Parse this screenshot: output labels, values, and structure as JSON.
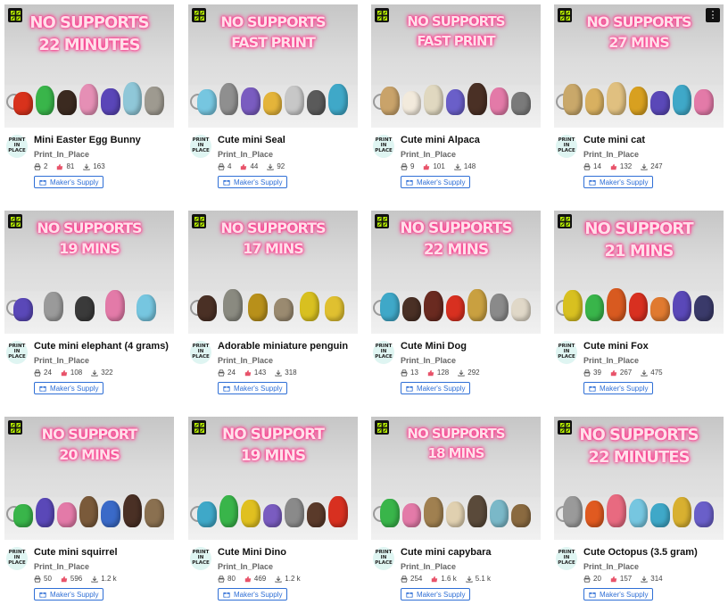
{
  "cards": [
    {
      "title": "Mini Easter Egg Bunny",
      "author": "Print_In_Place",
      "makes": "2",
      "likes": "81",
      "downloads": "163",
      "supply": "Maker's Supply",
      "headline": [
        "NO SUPPORTS",
        "22 MINUTES"
      ],
      "logo": [
        "PRINT",
        "IN",
        "PLACE"
      ],
      "colors": [
        "#d8321c",
        "#39b54a",
        "#3b2a20",
        "#e58fb5",
        "#5a46b8",
        "#8fc7d8",
        "#9e9a90"
      ]
    },
    {
      "title": "Cute mini Seal",
      "author": "Print_In_Place",
      "makes": "4",
      "likes": "44",
      "downloads": "92",
      "supply": "Maker's Supply",
      "headline": [
        "NO SUPPORTS",
        "FAST PRINT"
      ],
      "logo": [
        "PRINT",
        "IN",
        "PLACE"
      ],
      "colors": [
        "#76c6e0",
        "#8f8f8f",
        "#7a5cc0",
        "#e4b43a",
        "#c7c7c7",
        "#5a5a5a",
        "#3fa8c8"
      ]
    },
    {
      "title": "Cute mini Alpaca",
      "author": "Print_In_Place",
      "makes": "9",
      "likes": "101",
      "downloads": "148",
      "supply": "Maker's Supply",
      "headline": [
        "NO SUPPORTS",
        "FAST PRINT"
      ],
      "logo": [
        "PRINT",
        "IN",
        "PLACE"
      ],
      "colors": [
        "#c9a36a",
        "#f2eadc",
        "#e0d8c0",
        "#6a5fc9",
        "#4a3025",
        "#e37aa8",
        "#7a7a7a"
      ]
    },
    {
      "title": "Cute mini cat",
      "author": "Print_In_Place",
      "makes": "14",
      "likes": "132",
      "downloads": "247",
      "supply": "Maker's Supply",
      "headline": [
        "NO SUPPORTS",
        "27 MINS"
      ],
      "logo": [
        "PRINT",
        "IN",
        "PLACE"
      ],
      "colors": [
        "#c9a86a",
        "#d8b060",
        "#e0c080",
        "#d8a020",
        "#5a48b8",
        "#3fa8c8",
        "#e37aa8"
      ]
    },
    {
      "title": "Cute mini elephant (4 grams)",
      "author": "Print_In_Place",
      "makes": "24",
      "likes": "108",
      "downloads": "322",
      "supply": "Maker's Supply",
      "headline": [
        "NO SUPPORTS",
        "19 MINS"
      ],
      "logo": [
        "PRINT",
        "IN",
        "PLACE"
      ],
      "colors": [
        "#5a48b8",
        "#9a9a9a",
        "#3a3a3a",
        "#e37aa8",
        "#76c6e0"
      ]
    },
    {
      "title": "Adorable miniature penguin",
      "author": "Print_In_Place",
      "makes": "24",
      "likes": "143",
      "downloads": "318",
      "supply": "Maker's Supply",
      "headline": [
        "NO SUPPORTS",
        "17 MINS"
      ],
      "logo": [
        "PRINT",
        "IN",
        "PLACE"
      ],
      "colors": [
        "#4a3025",
        "#8a8a80",
        "#b8901a",
        "#9a8a70",
        "#d8c020",
        "#e0c030"
      ]
    },
    {
      "title": "Cute Mini Dog",
      "author": "Print_In_Place",
      "makes": "13",
      "likes": "128",
      "downloads": "292",
      "supply": "Maker's Supply",
      "headline": [
        "NO SUPPORTS",
        "22 MINS"
      ],
      "logo": [
        "PRINT",
        "IN",
        "PLACE"
      ],
      "colors": [
        "#3fa8c8",
        "#4a3025",
        "#6a2a20",
        "#d83020",
        "#c9a040",
        "#8a8a8a",
        "#e0d8c8"
      ]
    },
    {
      "title": "Cute mini Fox",
      "author": "Print_In_Place",
      "makes": "39",
      "likes": "267",
      "downloads": "475",
      "supply": "Maker's Supply",
      "headline": [
        "NO SUPPORT",
        "21 MINS"
      ],
      "logo": [
        "PRINT",
        "IN",
        "PLACE"
      ],
      "colors": [
        "#d8c020",
        "#39b54a",
        "#d85a20",
        "#d83020",
        "#e07a30",
        "#5a48b8",
        "#3a3a6a"
      ]
    },
    {
      "title": "Cute mini squirrel",
      "author": "Print_In_Place",
      "makes": "50",
      "likes": "596",
      "downloads": "1.2 k",
      "supply": "Maker's Supply",
      "headline": [
        "NO SUPPORT",
        "20 MINS"
      ],
      "logo": [
        "PRINT",
        "IN",
        "PLACE"
      ],
      "colors": [
        "#39b54a",
        "#5a48b8",
        "#e37aa8",
        "#7a5a3a",
        "#3a6ac8",
        "#4a3025",
        "#8a7050"
      ]
    },
    {
      "title": "Cute Mini Dino",
      "author": "Print_In_Place",
      "makes": "80",
      "likes": "469",
      "downloads": "1.2 k",
      "supply": "Maker's Supply",
      "headline": [
        "NO SUPPORT",
        "19 MINS"
      ],
      "logo": [
        "PRINT",
        "IN",
        "PLACE"
      ],
      "colors": [
        "#3fa8c8",
        "#39b54a",
        "#e0c020",
        "#7a5cc0",
        "#8a8a8a",
        "#5a3a2a",
        "#d83020"
      ]
    },
    {
      "title": "Cute mini capybara",
      "author": "Print_In_Place",
      "makes": "254",
      "likes": "1.6 k",
      "downloads": "5.1 k",
      "supply": "Maker's Supply",
      "headline": [
        "NO SUPPORTS",
        "18 MINS"
      ],
      "logo": [
        "PRINT",
        "IN",
        "PLACE"
      ],
      "colors": [
        "#39b54a",
        "#e37aa8",
        "#a08050",
        "#e0d0b0",
        "#5a4a3a",
        "#7ab8c8",
        "#8a6a40"
      ]
    },
    {
      "title": "Cute Octopus (3.5 gram)",
      "author": "Print_In_Place",
      "makes": "20",
      "likes": "157",
      "downloads": "314",
      "supply": "Maker's Supply",
      "headline": [
        "NO SUPPORTS",
        "22 MINUTES"
      ],
      "logo": [
        "PRINT",
        "IN",
        "PLACE"
      ],
      "colors": [
        "#9a9a9a",
        "#e05a20",
        "#e86a80",
        "#76c6e0",
        "#3fa8c8",
        "#d8b030",
        "#6a5fc9"
      ]
    }
  ],
  "more_options_label": "⋮"
}
